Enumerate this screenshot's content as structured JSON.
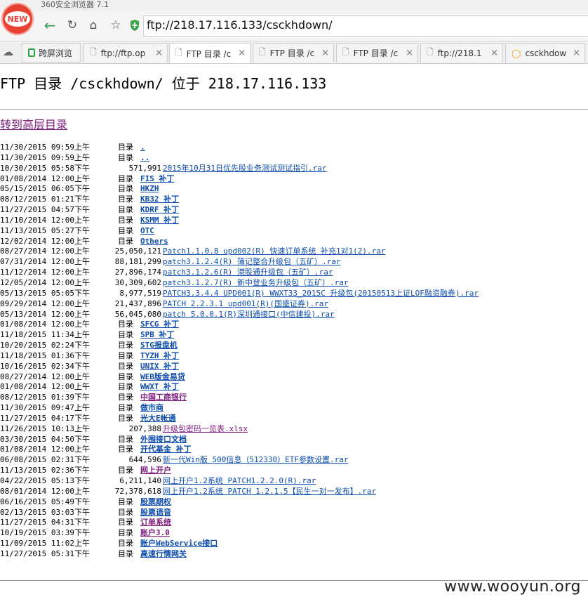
{
  "app": {
    "title": "360安全浏览器 7.1",
    "logo_text": "NEW"
  },
  "address": {
    "url": "ftp://218.17.116.133/csckhdown/"
  },
  "tabs": [
    {
      "label": "跨屏浏览",
      "type": "green"
    },
    {
      "label": "ftp://ftp.op",
      "type": "page",
      "close": "×"
    },
    {
      "label": "FTP 目录 /c",
      "type": "page",
      "close": "×",
      "active": true
    },
    {
      "label": "FTP 目录 /c",
      "type": "page",
      "close": "×"
    },
    {
      "label": "FTP 目录 /c",
      "type": "page",
      "close": "×"
    },
    {
      "label": "ftp://218.1",
      "type": "page",
      "close": "×"
    },
    {
      "label": "csckhdow",
      "type": "search",
      "close": "×"
    }
  ],
  "page": {
    "heading": "FTP 目录 /csckhdown/ 位于 218.17.116.133",
    "parent_link": "转到高层目录",
    "dir_label": "目录"
  },
  "entries": [
    {
      "date": "11/30/2015 09:59上午",
      "dir": true,
      "name": ".",
      "visited": false
    },
    {
      "date": "11/30/2015 09:59上午",
      "dir": true,
      "name": "..",
      "visited": false
    },
    {
      "date": "10/30/2015 05:58下午",
      "size": "571,991",
      "name": "2015年10月31日优先股业务测试测试指引.rar"
    },
    {
      "date": "01/08/2014 12:00上午",
      "dir": true,
      "name": "FIS 补丁"
    },
    {
      "date": "05/15/2015 06:05下午",
      "dir": true,
      "name": "HKZH"
    },
    {
      "date": "08/12/2015 01:21下午",
      "dir": true,
      "name": "KB32 补丁"
    },
    {
      "date": "11/27/2015 04:57下午",
      "dir": true,
      "name": "KDRF 补丁"
    },
    {
      "date": "11/10/2014 12:00上午",
      "dir": true,
      "name": "KSMM 补丁"
    },
    {
      "date": "11/13/2015 05:27下午",
      "dir": true,
      "name": "OTC"
    },
    {
      "date": "12/02/2014 12:00上午",
      "dir": true,
      "name": "Others"
    },
    {
      "date": "08/27/2014 12:00上午",
      "size": "25,050,121",
      "name": "Patch1.1.0.8 upd002(R) 快速订单系统 补充1对1(2).rar"
    },
    {
      "date": "07/31/2014 12:00上午",
      "size": "88,181,299",
      "name": "patch3.1.2.4(R) 簿记整合升级包（五矿）.rar"
    },
    {
      "date": "11/12/2014 12:00上午",
      "size": "27,896,174",
      "name": "patch3.1.2.6(R)  港股通升级包（五矿）.rar"
    },
    {
      "date": "12/05/2014 12:00上午",
      "size": "30,309,602",
      "name": "patch3.1.2.7(R) 新中登业务升级包（五矿）.rar"
    },
    {
      "date": "05/13/2015 05:05下午",
      "size": "8,977,519",
      "name": "PATCH3.3.4.4 UPD001(R) WWXT33_2015C 升级包(20150513上证LOF融资融券).rar"
    },
    {
      "date": "09/29/2014 12:00上午",
      "size": "21,437,896",
      "name": "PATCH 2.2.3.1 upd001(R)(国盛证券).rar"
    },
    {
      "date": "05/13/2014 12:00上午",
      "size": "56,045,080",
      "name": "patch 5.0.0.1(R)深圳通接口(中信建投).rar"
    },
    {
      "date": "01/08/2014 12:00上午",
      "dir": true,
      "name": "SFCG 补丁"
    },
    {
      "date": "11/18/2015 11:34上午",
      "dir": true,
      "name": "SPB 补丁"
    },
    {
      "date": "10/20/2015 02:24下午",
      "dir": true,
      "name": "STG报盘机"
    },
    {
      "date": "11/18/2015 01:36下午",
      "dir": true,
      "name": "TYZH 补丁"
    },
    {
      "date": "10/16/2015 02:34下午",
      "dir": true,
      "name": "UNIX 补丁"
    },
    {
      "date": "08/27/2014 12:00上午",
      "dir": true,
      "name": "WEB版金易贷"
    },
    {
      "date": "01/08/2014 12:00上午",
      "dir": true,
      "name": "WWXT 补丁"
    },
    {
      "date": "08/12/2015 01:39下午",
      "dir": true,
      "name": "中国工商银行",
      "visited": true
    },
    {
      "date": "11/30/2015 09:47上午",
      "dir": true,
      "name": "做市商"
    },
    {
      "date": "11/27/2015 04:17下午",
      "dir": true,
      "name": "光大E帐通"
    },
    {
      "date": "11/26/2015 10:13上午",
      "size": "207,388",
      "name": "升级包密码一览表.xlsx",
      "visited": true
    },
    {
      "date": "03/30/2015 04:50下午",
      "dir": true,
      "name": "外围接口文档"
    },
    {
      "date": "01/08/2014 12:00上午",
      "dir": true,
      "name": "开代基金 补丁"
    },
    {
      "date": "06/08/2015 02:31下午",
      "size": "644,596",
      "name": "新一代Win版 500信息（512330）ETF参数设置.rar"
    },
    {
      "date": "11/13/2015 02:36下午",
      "dir": true,
      "name": "网上开户",
      "visited": true
    },
    {
      "date": "04/22/2015 05:13下午",
      "size": "6,211,140",
      "name": "网上开户1.2系统 PATCH1.2.2.0(R).rar"
    },
    {
      "date": "08/01/2014 12:00上午",
      "size": "72,378,618",
      "name": "网上开户1.2系统 PATCH 1.2.1.5【民生一对一发布】.rar"
    },
    {
      "date": "06/16/2015 05:49下午",
      "dir": true,
      "name": "股票期权"
    },
    {
      "date": "02/13/2015 03:03下午",
      "dir": true,
      "name": "股票语音"
    },
    {
      "date": "11/27/2015 04:31下午",
      "dir": true,
      "name": "订单系统",
      "visited": true
    },
    {
      "date": "10/19/2015 03:39下午",
      "dir": true,
      "name": "账户3.0",
      "visited": true
    },
    {
      "date": "11/09/2015 11:02上午",
      "dir": true,
      "name": "账户WebService接口"
    },
    {
      "date": "11/27/2015 05:31下午",
      "dir": true,
      "name": "高速行情网关"
    }
  ],
  "watermark": "www.wooyun.org",
  "colors": {
    "link": "#0e4dad",
    "visited": "#7d1b7d",
    "logo": "#e84235",
    "back_arrow": "#36a350"
  }
}
